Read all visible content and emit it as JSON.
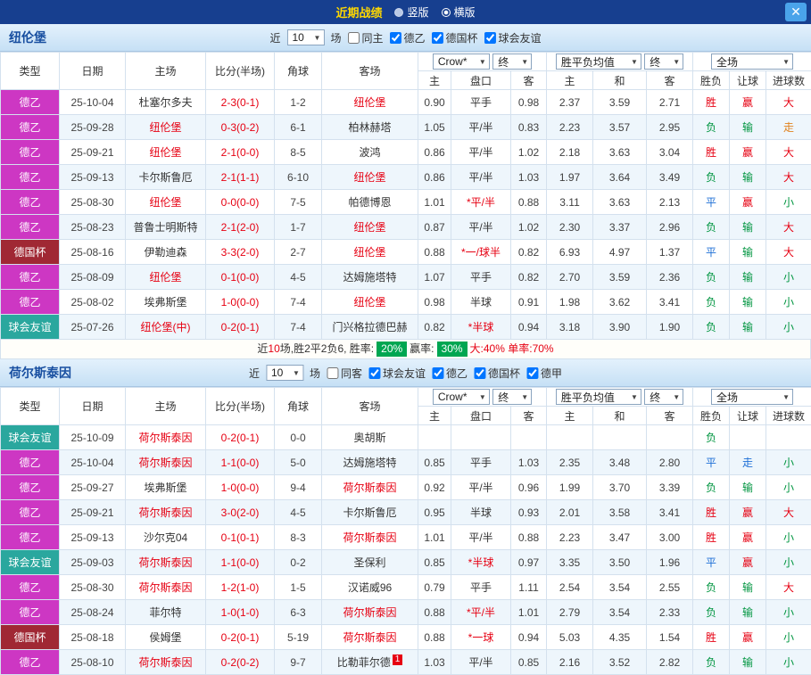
{
  "titlebar": {
    "title": "近期战绩",
    "options": [
      {
        "label": "竖版",
        "selected": false
      },
      {
        "label": "横版",
        "selected": true
      }
    ],
    "close_icon": "✕"
  },
  "header_labels": {
    "near": "近",
    "count": "10",
    "games": "场"
  },
  "columns": {
    "left": [
      "类型",
      "日期",
      "主场",
      "比分(半场)",
      "角球",
      "客场"
    ],
    "odds_selects": [
      "Crow*",
      "终"
    ],
    "avg_selects": [
      "胜平负均值",
      "终"
    ],
    "scope_select": "全场",
    "sub": [
      "主",
      "盘口",
      "客",
      "主",
      "和",
      "客",
      "胜负",
      "让球",
      "进球数"
    ]
  },
  "colors": {
    "topbar": "#173f8f",
    "title": "#ffd800",
    "close_bg": "#4aa3ea",
    "win": "#e60012",
    "lose": "#009540",
    "draw": "#1d6fd6",
    "walk": "#e0821e",
    "badge": "#00a651",
    "team_normal": "#333333",
    "types": {
      "德乙": "#cd37c3",
      "德国杯": "#a02834",
      "球会友谊": "#2aa79e"
    }
  },
  "tables": [
    {
      "team": "纽伦堡",
      "checkboxes": [
        {
          "label": "同主",
          "checked": false
        },
        {
          "label": "德乙",
          "checked": true
        },
        {
          "label": "德国杯",
          "checked": true
        },
        {
          "label": "球会友谊",
          "checked": true
        }
      ],
      "rows": [
        {
          "type": "德乙",
          "date": "25-10-04",
          "home": "杜塞尔多夫",
          "home_hl": false,
          "score": "2-3(0-1)",
          "corner": "1-2",
          "away": "纽伦堡",
          "away_hl": true,
          "away_badge": "",
          "w1": "0.90",
          "handicap": "平手",
          "w2": "0.98",
          "o1": "2.37",
          "o2": "3.59",
          "o3": "2.71",
          "r1": "胜",
          "r2": "赢",
          "r3": "大"
        },
        {
          "type": "德乙",
          "date": "25-09-28",
          "home": "纽伦堡",
          "home_hl": true,
          "score": "0-3(0-2)",
          "corner": "6-1",
          "away": "柏林赫塔",
          "away_hl": false,
          "away_badge": "",
          "w1": "1.05",
          "handicap": "平/半",
          "w2": "0.83",
          "o1": "2.23",
          "o2": "3.57",
          "o3": "2.95",
          "r1": "负",
          "r2": "输",
          "r3": "走"
        },
        {
          "type": "德乙",
          "date": "25-09-21",
          "home": "纽伦堡",
          "home_hl": true,
          "score": "2-1(0-0)",
          "corner": "8-5",
          "away": "波鸿",
          "away_hl": false,
          "away_badge": "",
          "w1": "0.86",
          "handicap": "平/半",
          "w2": "1.02",
          "o1": "2.18",
          "o2": "3.63",
          "o3": "3.04",
          "r1": "胜",
          "r2": "赢",
          "r3": "大"
        },
        {
          "type": "德乙",
          "date": "25-09-13",
          "home": "卡尔斯鲁厄",
          "home_hl": false,
          "score": "2-1(1-1)",
          "corner": "6-10",
          "away": "纽伦堡",
          "away_hl": true,
          "away_badge": "",
          "w1": "0.86",
          "handicap": "平/半",
          "w2": "1.03",
          "o1": "1.97",
          "o2": "3.64",
          "o3": "3.49",
          "r1": "负",
          "r2": "输",
          "r3": "大"
        },
        {
          "type": "德乙",
          "date": "25-08-30",
          "home": "纽伦堡",
          "home_hl": true,
          "score": "0-0(0-0)",
          "corner": "7-5",
          "away": "帕德博恩",
          "away_hl": false,
          "away_badge": "",
          "w1": "1.01",
          "handicap": "*平/半",
          "w2": "0.88",
          "o1": "3.11",
          "o2": "3.63",
          "o3": "2.13",
          "r1": "平",
          "r2": "赢",
          "r3": "小"
        },
        {
          "type": "德乙",
          "date": "25-08-23",
          "home": "普鲁士明斯特",
          "home_hl": false,
          "score": "2-1(2-0)",
          "corner": "1-7",
          "away": "纽伦堡",
          "away_hl": true,
          "away_badge": "",
          "w1": "0.87",
          "handicap": "平/半",
          "w2": "1.02",
          "o1": "2.30",
          "o2": "3.37",
          "o3": "2.96",
          "r1": "负",
          "r2": "输",
          "r3": "大"
        },
        {
          "type": "德国杯",
          "date": "25-08-16",
          "home": "伊勒迪森",
          "home_hl": false,
          "score": "3-3(2-0)",
          "corner": "2-7",
          "away": "纽伦堡",
          "away_hl": true,
          "away_badge": "",
          "w1": "0.88",
          "handicap": "*一/球半",
          "w2": "0.82",
          "o1": "6.93",
          "o2": "4.97",
          "o3": "1.37",
          "r1": "平",
          "r2": "输",
          "r3": "大"
        },
        {
          "type": "德乙",
          "date": "25-08-09",
          "home": "纽伦堡",
          "home_hl": true,
          "score": "0-1(0-0)",
          "corner": "4-5",
          "away": "达姆施塔特",
          "away_hl": false,
          "away_badge": "",
          "w1": "1.07",
          "handicap": "平手",
          "w2": "0.82",
          "o1": "2.70",
          "o2": "3.59",
          "o3": "2.36",
          "r1": "负",
          "r2": "输",
          "r3": "小"
        },
        {
          "type": "德乙",
          "date": "25-08-02",
          "home": "埃弗斯堡",
          "home_hl": false,
          "score": "1-0(0-0)",
          "corner": "7-4",
          "away": "纽伦堡",
          "away_hl": true,
          "away_badge": "",
          "w1": "0.98",
          "handicap": "半球",
          "w2": "0.91",
          "o1": "1.98",
          "o2": "3.62",
          "o3": "3.41",
          "r1": "负",
          "r2": "输",
          "r3": "小"
        },
        {
          "type": "球会友谊",
          "date": "25-07-26",
          "home": "纽伦堡(中)",
          "home_hl": true,
          "score": "0-2(0-1)",
          "corner": "7-4",
          "away": "门兴格拉德巴赫",
          "away_hl": false,
          "away_badge": "",
          "w1": "0.82",
          "handicap": "*半球",
          "w2": "0.94",
          "o1": "3.18",
          "o2": "3.90",
          "o3": "1.90",
          "r1": "负",
          "r2": "输",
          "r3": "小"
        }
      ],
      "summary": [
        {
          "text": "近",
          "style": "plain"
        },
        {
          "text": "10",
          "style": "red"
        },
        {
          "text": "场,胜2平2负6, 胜率: ",
          "style": "plain"
        },
        {
          "text": "20%",
          "style": "badge"
        },
        {
          "text": " 赢率: ",
          "style": "plain"
        },
        {
          "text": "30%",
          "style": "badge"
        },
        {
          "text": " 大:40% 单率:70%",
          "style": "red"
        }
      ]
    },
    {
      "team": "荷尔斯泰因",
      "checkboxes": [
        {
          "label": "同客",
          "checked": false
        },
        {
          "label": "球会友谊",
          "checked": true
        },
        {
          "label": "德乙",
          "checked": true
        },
        {
          "label": "德国杯",
          "checked": true
        },
        {
          "label": "德甲",
          "checked": true
        }
      ],
      "rows": [
        {
          "type": "球会友谊",
          "date": "25-10-09",
          "home": "荷尔斯泰因",
          "home_hl": true,
          "score": "0-2(0-1)",
          "corner": "0-0",
          "away": "奥胡斯",
          "away_hl": false,
          "away_badge": "",
          "w1": "",
          "handicap": "",
          "w2": "",
          "o1": "",
          "o2": "",
          "o3": "",
          "r1": "负",
          "r2": "",
          "r3": ""
        },
        {
          "type": "德乙",
          "date": "25-10-04",
          "home": "荷尔斯泰因",
          "home_hl": true,
          "score": "1-1(0-0)",
          "corner": "5-0",
          "away": "达姆施塔特",
          "away_hl": false,
          "away_badge": "",
          "w1": "0.85",
          "handicap": "平手",
          "w2": "1.03",
          "o1": "2.35",
          "o2": "3.48",
          "o3": "2.80",
          "r1": "平",
          "r2": "走",
          "r3": "小"
        },
        {
          "type": "德乙",
          "date": "25-09-27",
          "home": "埃弗斯堡",
          "home_hl": false,
          "score": "1-0(0-0)",
          "corner": "9-4",
          "away": "荷尔斯泰因",
          "away_hl": true,
          "away_badge": "",
          "w1": "0.92",
          "handicap": "平/半",
          "w2": "0.96",
          "o1": "1.99",
          "o2": "3.70",
          "o3": "3.39",
          "r1": "负",
          "r2": "输",
          "r3": "小"
        },
        {
          "type": "德乙",
          "date": "25-09-21",
          "home": "荷尔斯泰因",
          "home_hl": true,
          "score": "3-0(2-0)",
          "corner": "4-5",
          "away": "卡尔斯鲁厄",
          "away_hl": false,
          "away_badge": "",
          "w1": "0.95",
          "handicap": "半球",
          "w2": "0.93",
          "o1": "2.01",
          "o2": "3.58",
          "o3": "3.41",
          "r1": "胜",
          "r2": "赢",
          "r3": "大"
        },
        {
          "type": "德乙",
          "date": "25-09-13",
          "home": "沙尔克04",
          "home_hl": false,
          "score": "0-1(0-1)",
          "corner": "8-3",
          "away": "荷尔斯泰因",
          "away_hl": true,
          "away_badge": "",
          "w1": "1.01",
          "handicap": "平/半",
          "w2": "0.88",
          "o1": "2.23",
          "o2": "3.47",
          "o3": "3.00",
          "r1": "胜",
          "r2": "赢",
          "r3": "小"
        },
        {
          "type": "球会友谊",
          "date": "25-09-03",
          "home": "荷尔斯泰因",
          "home_hl": true,
          "score": "1-1(0-0)",
          "corner": "0-2",
          "away": "圣保利",
          "away_hl": false,
          "away_badge": "",
          "w1": "0.85",
          "handicap": "*半球",
          "w2": "0.97",
          "o1": "3.35",
          "o2": "3.50",
          "o3": "1.96",
          "r1": "平",
          "r2": "赢",
          "r3": "小"
        },
        {
          "type": "德乙",
          "date": "25-08-30",
          "home": "荷尔斯泰因",
          "home_hl": true,
          "score": "1-2(1-0)",
          "corner": "1-5",
          "away": "汉诺威96",
          "away_hl": false,
          "away_badge": "",
          "w1": "0.79",
          "handicap": "平手",
          "w2": "1.11",
          "o1": "2.54",
          "o2": "3.54",
          "o3": "2.55",
          "r1": "负",
          "r2": "输",
          "r3": "大"
        },
        {
          "type": "德乙",
          "date": "25-08-24",
          "home": "菲尔特",
          "home_hl": false,
          "score": "1-0(1-0)",
          "corner": "6-3",
          "away": "荷尔斯泰因",
          "away_hl": true,
          "away_badge": "",
          "w1": "0.88",
          "handicap": "*平/半",
          "w2": "1.01",
          "o1": "2.79",
          "o2": "3.54",
          "o3": "2.33",
          "r1": "负",
          "r2": "输",
          "r3": "小"
        },
        {
          "type": "德国杯",
          "date": "25-08-18",
          "home": "侯姆堡",
          "home_hl": false,
          "score": "0-2(0-1)",
          "corner": "5-19",
          "away": "荷尔斯泰因",
          "away_hl": true,
          "away_badge": "",
          "w1": "0.88",
          "handicap": "*一球",
          "w2": "0.94",
          "o1": "5.03",
          "o2": "4.35",
          "o3": "1.54",
          "r1": "胜",
          "r2": "赢",
          "r3": "小"
        },
        {
          "type": "德乙",
          "date": "25-08-10",
          "home": "荷尔斯泰因",
          "home_hl": true,
          "score": "0-2(0-2)",
          "corner": "9-7",
          "away": "比勒菲尔德",
          "away_hl": false,
          "away_badge": "1",
          "w1": "1.03",
          "handicap": "平/半",
          "w2": "0.85",
          "o1": "2.16",
          "o2": "3.52",
          "o3": "2.82",
          "r1": "负",
          "r2": "输",
          "r3": "小"
        }
      ],
      "summary": null
    }
  ]
}
